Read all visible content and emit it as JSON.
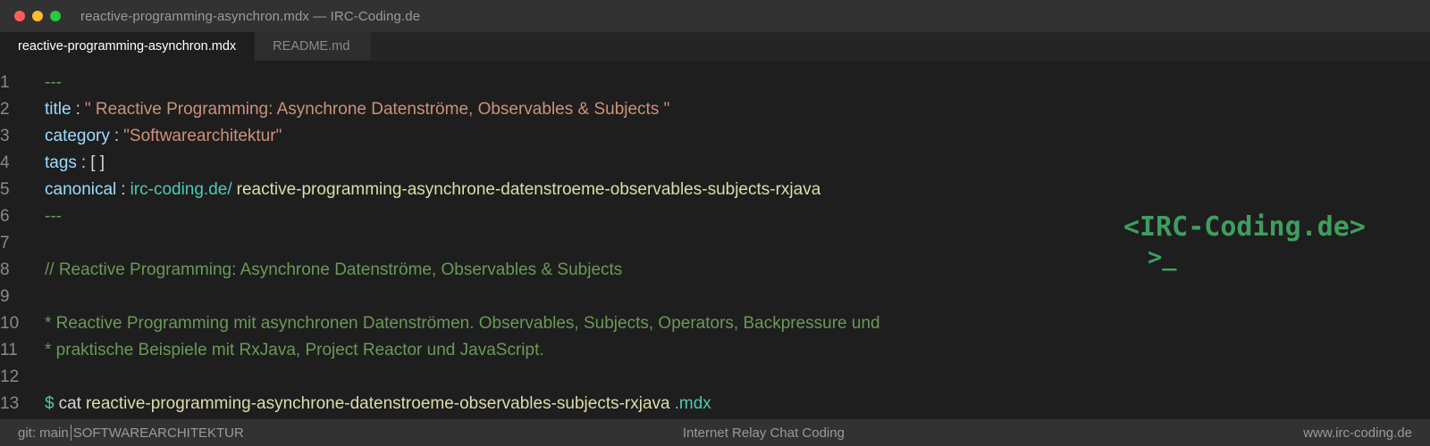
{
  "window": {
    "title": "reactive-programming-asynchron.mdx — IRC-Coding.de"
  },
  "tabs": [
    {
      "label": "reactive-programming-asynchron.mdx",
      "active": true
    },
    {
      "label": "README.md",
      "active": false
    }
  ],
  "editor": {
    "line_numbers": [
      "1",
      "2",
      "3",
      "4",
      "5",
      "6",
      "7",
      "8",
      "9",
      "10",
      "11",
      "12",
      "13"
    ],
    "frontmatter_delim": "---",
    "title_key": "title",
    "title_value": "\" Reactive Programming: Asynchrone Datenströme, Observables & Subjects \"",
    "category_key": "category",
    "category_value": "\"Softwarearchitektur\"",
    "tags_key": "tags",
    "tags_value": "[ ]",
    "canonical_key": "canonical",
    "canonical_domain": "irc-coding.de/",
    "canonical_path": "reactive-programming-asynchrone-datenstroeme-observables-subjects-rxjava",
    "colon": ":",
    "comment_line": "// Reactive Programming: Asynchrone Datenströme, Observables & Subjects",
    "desc_line_1": "* Reactive Programming mit asynchronen Datenströmen. Observables, Subjects, Operators, Backpressure und",
    "desc_line_2": "* praktische Beispiele mit RxJava, Project Reactor und JavaScript.",
    "prompt_symbol": "$",
    "command": "cat",
    "command_file": "reactive-programming-asynchrone-datenstroeme-observables-subjects-rxjava",
    "command_ext": ".mdx"
  },
  "logo": {
    "text": "<IRC-Coding.de>",
    "prompt": ">_"
  },
  "statusbar": {
    "branch": "git: main",
    "category": "SOFTWAREARCHITEKTUR",
    "center": "Internet Relay Chat Coding",
    "right": "www.irc-coding.de"
  },
  "colors": {
    "background": "#1e1e1e",
    "titlebar": "#323232",
    "keyword": "#9cdcfe",
    "string": "#ce9178",
    "comment": "#6a9955",
    "url": "#4ec9b0",
    "path": "#dcdcaa",
    "logo": "#3f9e5f"
  }
}
